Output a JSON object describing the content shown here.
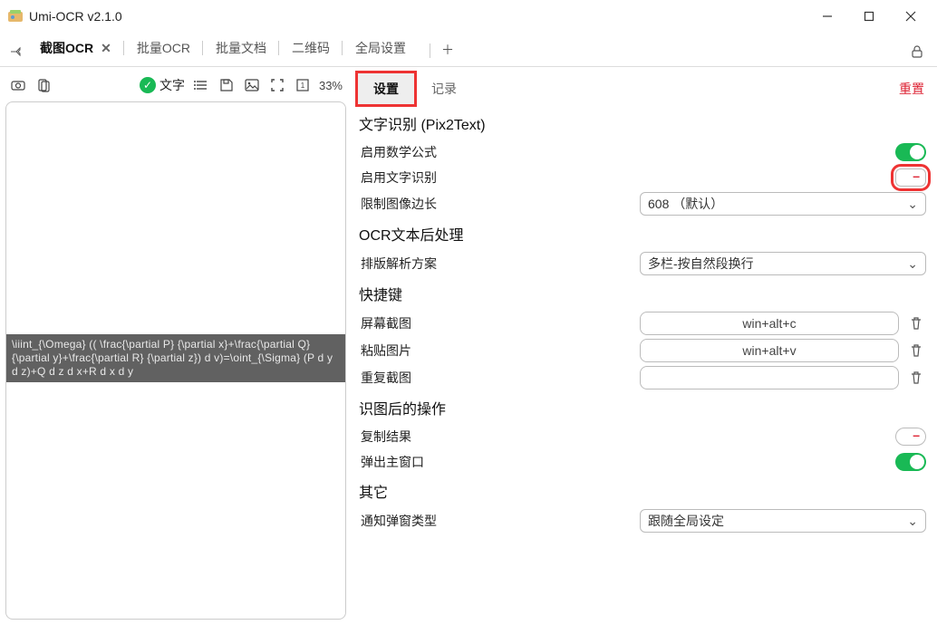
{
  "titlebar": {
    "title": "Umi-OCR v2.1.0"
  },
  "tabs": {
    "items": [
      {
        "label": "截图OCR",
        "active": true,
        "closable": true
      },
      {
        "label": "批量OCR"
      },
      {
        "label": "批量文档"
      },
      {
        "label": "二维码"
      },
      {
        "label": "全局设置"
      }
    ]
  },
  "left": {
    "chip_label": "文字",
    "zoom": "33%",
    "latex_overlay": "\\iiint_{\\Omega} (( \\frac{\\partial P} {\\partial x}+\\frac{\\partial Q} {\\partial y}+\\frac{\\partial R} {\\partial z}) d v)=\\oint_{\\Sigma} (P d y d z)+Q d z d x+R d x d y"
  },
  "right": {
    "tabs": {
      "settings": "设置",
      "history": "记录",
      "reset": "重置"
    },
    "sections": {
      "ocr_engine": {
        "title": "文字识别 (Pix2Text)",
        "math": "启用数学公式",
        "text": "启用文字识别",
        "limit": "限制图像边长",
        "limit_value": "608 （默认）"
      },
      "post": {
        "title": "OCR文本后处理",
        "layout": "排版解析方案",
        "layout_value": "多栏-按自然段换行"
      },
      "shortcuts": {
        "title": "快捷键",
        "screenshot": "屏幕截图",
        "screenshot_value": "win+alt+c",
        "paste": "粘贴图片",
        "paste_value": "win+alt+v",
        "repeat": "重复截图"
      },
      "after": {
        "title": "识图后的操作",
        "copy": "复制结果",
        "popup": "弹出主窗口"
      },
      "other": {
        "title": "其它",
        "notify": "通知弹窗类型",
        "notify_value": "跟随全局设定"
      }
    }
  }
}
